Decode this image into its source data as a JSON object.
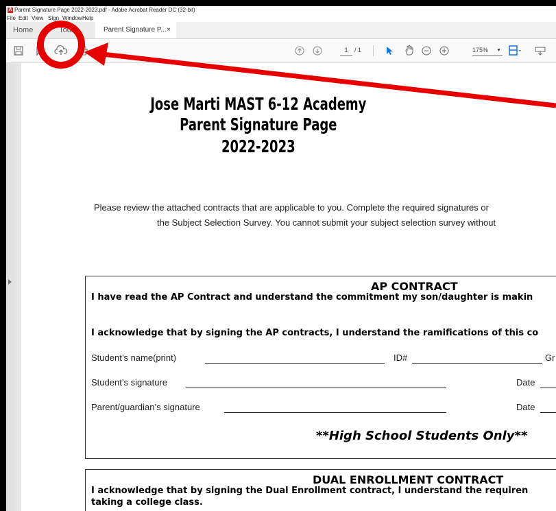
{
  "window": {
    "title": "Parent Signature Page 2022-2023.pdf - Adobe Acrobat Reader DC (32-bit)",
    "app_icon": "acrobat-icon"
  },
  "menu": [
    "File",
    "Edit",
    "View",
    "Sign",
    "Window",
    "Help"
  ],
  "tabs": {
    "home": "Home",
    "tools": "Tools",
    "document": "Parent Signature P...",
    "close_glyph": "×"
  },
  "toolbar": {
    "icons": [
      "save-icon",
      "bookmark-icon",
      "upload-cloud-icon",
      "print-icon",
      "search-icon",
      "prev-page-icon",
      "next-page-icon",
      "select-arrow-icon",
      "hand-icon",
      "zoom-out-icon",
      "zoom-in-icon",
      "fit-page-icon",
      "keyboard-icon"
    ],
    "page_current": "1",
    "page_total": "/ 1",
    "zoom": "175%"
  },
  "document": {
    "school": "Jose Marti MAST 6-12 Academy",
    "heading": "Parent Signature Page",
    "year": "2022-2023",
    "intro_line1": "Please review the attached contracts that are applicable to you. Complete the required signatures or",
    "intro_line2": "the Subject Selection Survey. You cannot submit your subject selection survey without",
    "ap": {
      "title": "AP CONTRACT",
      "line1": "I have read the AP Contract and understand the commitment my son/daughter is makin",
      "line2": "I acknowledge that by signing the AP contracts, I understand the ramifications of this co",
      "student_name_label": "Student’s name(print)",
      "id_label": "ID#",
      "grade_label": "Gr",
      "student_sig_label": "Student’s signature",
      "date_label": "Date",
      "parent_sig_label": "Parent/guardian’s signature",
      "date_label_2": "Date",
      "note": "**High School Students Only**"
    },
    "dual": {
      "title": "DUAL ENROLLMENT CONTRACT",
      "line1": "I acknowledge that by signing the Dual Enrollment contract, I understand the requiren",
      "line2": "taking a college class."
    }
  },
  "annotation": {
    "color": "#e60000",
    "target": "Tools"
  }
}
